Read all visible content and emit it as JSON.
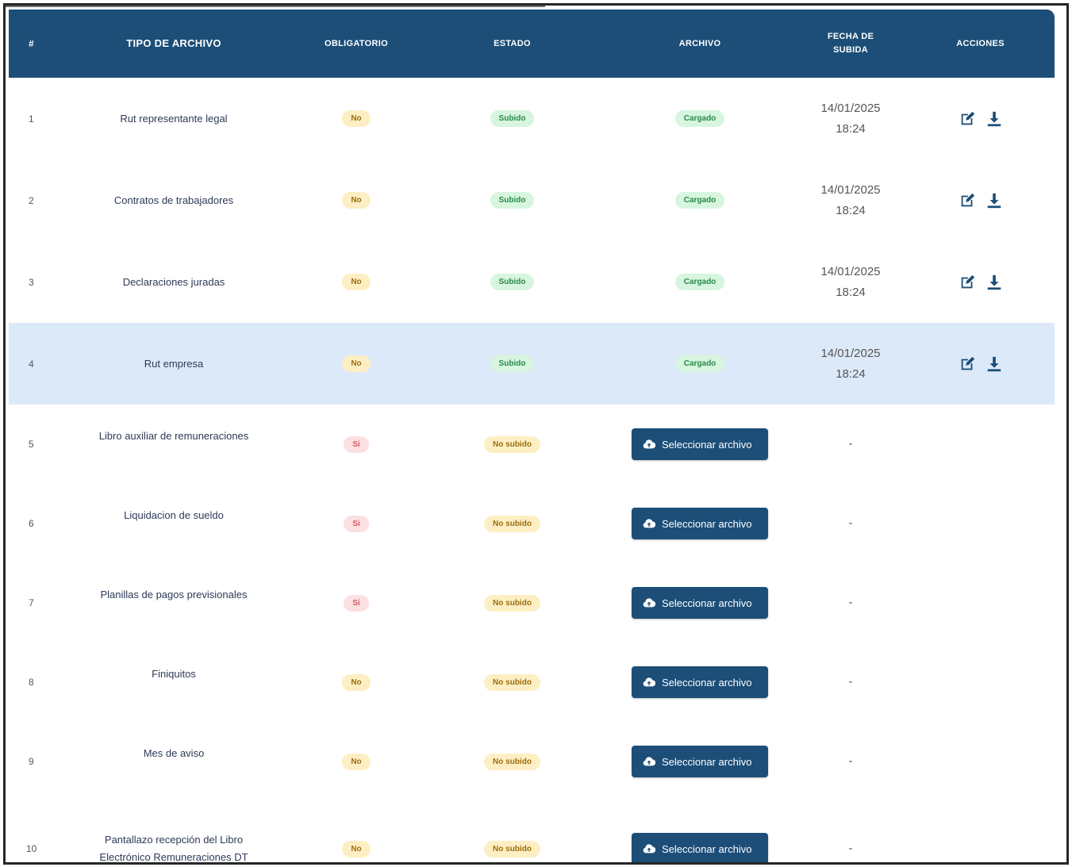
{
  "table": {
    "headers": {
      "num": "#",
      "tipo": "TIPO DE ARCHIVO",
      "obligatorio": "OBLIGATORIO",
      "estado": "ESTADO",
      "archivo": "ARCHIVO",
      "fecha_line1": "FECHA DE",
      "fecha_line2": "SUBIDA",
      "acciones": "ACCIONES"
    },
    "rows": [
      {
        "num": "1",
        "tipo": "Rut representante legal",
        "obligatorio": "No",
        "estado": "Subido",
        "archivo": "Cargado",
        "fecha": "14/01/2025",
        "hora": "18:24"
      },
      {
        "num": "2",
        "tipo": "Contratos de trabajadores",
        "obligatorio": "No",
        "estado": "Subido",
        "archivo": "Cargado",
        "fecha": "14/01/2025",
        "hora": "18:24"
      },
      {
        "num": "3",
        "tipo": "Declaraciones juradas",
        "obligatorio": "No",
        "estado": "Subido",
        "archivo": "Cargado",
        "fecha": "14/01/2025",
        "hora": "18:24"
      },
      {
        "num": "4",
        "tipo": "Rut empresa",
        "obligatorio": "No",
        "estado": "Subido",
        "archivo": "Cargado",
        "fecha": "14/01/2025",
        "hora": "18:24"
      },
      {
        "num": "5",
        "tipo": "Libro auxiliar de remuneraciones",
        "obligatorio": "Si",
        "estado": "No subido",
        "archivo": "Seleccionar archivo",
        "fecha": "-"
      },
      {
        "num": "6",
        "tipo": "Liquidacion de sueldo",
        "obligatorio": "Si",
        "estado": "No subido",
        "archivo": "Seleccionar archivo",
        "fecha": "-"
      },
      {
        "num": "7",
        "tipo": "Planillas de pagos previsionales",
        "obligatorio": "Si",
        "estado": "No subido",
        "archivo": "Seleccionar archivo",
        "fecha": "-"
      },
      {
        "num": "8",
        "tipo": "Finiquitos",
        "obligatorio": "No",
        "estado": "No subido",
        "archivo": "Seleccionar archivo",
        "fecha": "-"
      },
      {
        "num": "9",
        "tipo": "Mes de aviso",
        "obligatorio": "No",
        "estado": "No subido",
        "archivo": "Seleccionar archivo",
        "fecha": "-"
      },
      {
        "num": "10",
        "tipo_line1": "Pantallazo recepción del Libro",
        "tipo_line2": "Electrónico Remuneraciones DT",
        "obligatorio": "No",
        "estado": "No subido",
        "archivo": "Seleccionar archivo",
        "fecha": "-"
      }
    ]
  },
  "icons": {
    "edit": "edit-icon",
    "download": "download-icon",
    "upload": "cloud-upload-icon"
  },
  "colors": {
    "header_bg": "#1c4e78",
    "highlight_row": "#dce9f9",
    "pill_no": "#fdefc3",
    "pill_si": "#fde0e2",
    "pill_ok": "#d7f5df"
  }
}
